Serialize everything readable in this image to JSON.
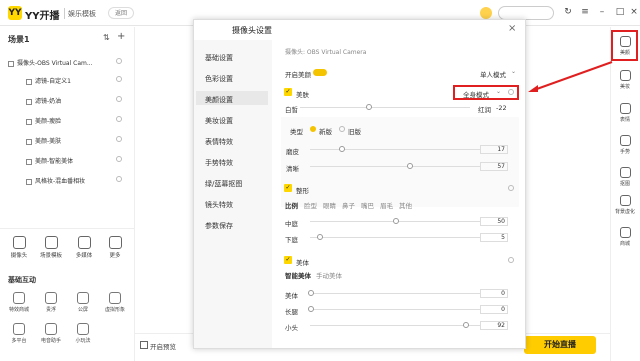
{
  "app": {
    "brand": "YY开播",
    "mode": "娱乐模板",
    "back": "返回"
  },
  "left": {
    "scene_title": "场景1",
    "tree": [
      "摄像头-OBS Virtual Cam...",
      "滤镜-自定义1",
      "滤镜-奶油",
      "美颜-瘦脸",
      "美颜-美肤",
      "美颜-智能美体",
      "风格妆-混血番相妆"
    ],
    "tools": [
      "摄像头",
      "场景模板",
      "多媒体",
      "更多"
    ],
    "basic_title": "基础互动",
    "interactions": [
      "特效商城",
      "贵浮",
      "公屏",
      "虚拟形象",
      "多平台",
      "电音助手",
      "小玩法"
    ]
  },
  "rail": [
    "美颜",
    "美妆",
    "表情",
    "手势",
    "抠图",
    "背景虚化",
    "商城"
  ],
  "dialog": {
    "title": "摄像头设置",
    "nav": [
      "基础设置",
      "色彩设置",
      "美颜设置",
      "美妆设置",
      "表情特效",
      "手势特效",
      "绿/蓝幕抠图",
      "镜头特效",
      "参数保存"
    ],
    "source": "摄像头: OBS Virtual Camera",
    "enable_beauty": "开启美颜",
    "single_mode": "单人模式",
    "skin": "美肤",
    "mode_select": "全身模式",
    "white": "白皙",
    "rosy": "红润",
    "rosy_val": "-22",
    "type_label": "类型",
    "type_new": "新版",
    "type_old": "旧版",
    "smooth": "磨皮",
    "smooth_val": "17",
    "clear": "清晰",
    "clear_val": "57",
    "shape": "整形",
    "shape_tabs": [
      "比例",
      "脸型",
      "眼睛",
      "鼻子",
      "嘴巴",
      "眉毛",
      "其他"
    ],
    "mid": "中庭",
    "mid_val": "50",
    "low": "下庭",
    "low_val": "5",
    "body": "美体",
    "body_tabs": [
      "智能美体",
      "手动美体"
    ],
    "b1": "美体",
    "b1_val": "0",
    "b2": "长腿",
    "b2_val": "0",
    "b3": "小头",
    "b3_val": "92"
  },
  "bottom": {
    "preview": "开启预览",
    "live": "开始直播"
  }
}
